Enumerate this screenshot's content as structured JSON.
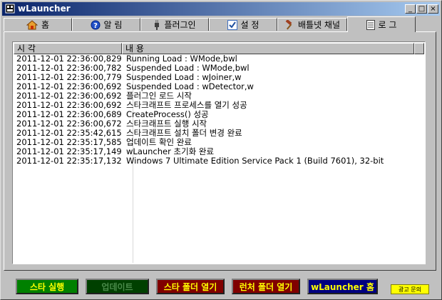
{
  "window": {
    "title": "wLauncher",
    "minimize": "_",
    "maximize": "□",
    "close": "×"
  },
  "tabs": [
    {
      "label": "홈",
      "icon": "home-icon"
    },
    {
      "label": "알  림",
      "icon": "help-icon"
    },
    {
      "label": "플러그인",
      "icon": "plug-icon"
    },
    {
      "label": "설  정",
      "icon": "checkbox-icon"
    },
    {
      "label": "배틀넷 채널",
      "icon": "hammer-icon"
    },
    {
      "label": "로  그",
      "icon": "document-icon",
      "active": true
    }
  ],
  "log": {
    "columns": [
      "시  각",
      "내  용"
    ],
    "rows": [
      {
        "time": "2011-12-01   22:36:00,829",
        "message": "Running Load : WMode,bwl"
      },
      {
        "time": "2011-12-01   22:36:00,782",
        "message": "Suspended Load : WMode,bwl"
      },
      {
        "time": "2011-12-01   22:36:00,779",
        "message": "Suspended Load : wJoiner,w"
      },
      {
        "time": "2011-12-01   22:36:00,692",
        "message": "Suspended Load : wDetector,w"
      },
      {
        "time": "2011-12-01   22:36:00,692",
        "message": "플러그인 로드 시작"
      },
      {
        "time": "2011-12-01   22:36:00,692",
        "message": "스타크래프트 프로세스를 열기 성공"
      },
      {
        "time": "2011-12-01   22:36:00,689",
        "message": "CreateProcess() 성공"
      },
      {
        "time": "2011-12-01   22:36:00,672",
        "message": "스타크래프트 실행 시작"
      },
      {
        "time": "2011-12-01   22:35:42,615",
        "message": "스타크래프트 설치 폴더 변경 완료"
      },
      {
        "time": "2011-12-01   22:35:17,585",
        "message": "업데이트 확인 완료"
      },
      {
        "time": "2011-12-01   22:35:17,149",
        "message": "wLauncher 초기화 완료"
      },
      {
        "time": "2011-12-01   22:35:17,132",
        "message": "Windows 7 Ultimate Edition Service Pack 1 (Build 7601), 32-bit"
      }
    ]
  },
  "buttons": {
    "start": "스타 실행",
    "update": "업데이트",
    "star_folder": "스타 폴더 열기",
    "launcher_folder": "런처 폴더 열기",
    "home": "wLauncher 홈",
    "ad": "광고 문의"
  },
  "colors": {
    "start_bg": "#008000",
    "start_fg": "#ffff00",
    "update_bg": "#004000",
    "update_fg": "#4a8a4a",
    "folder_bg": "#800000",
    "folder_fg": "#ffff00",
    "home_bg": "#000080",
    "home_fg": "#ffff00",
    "ad_bg": "#ffff00"
  }
}
